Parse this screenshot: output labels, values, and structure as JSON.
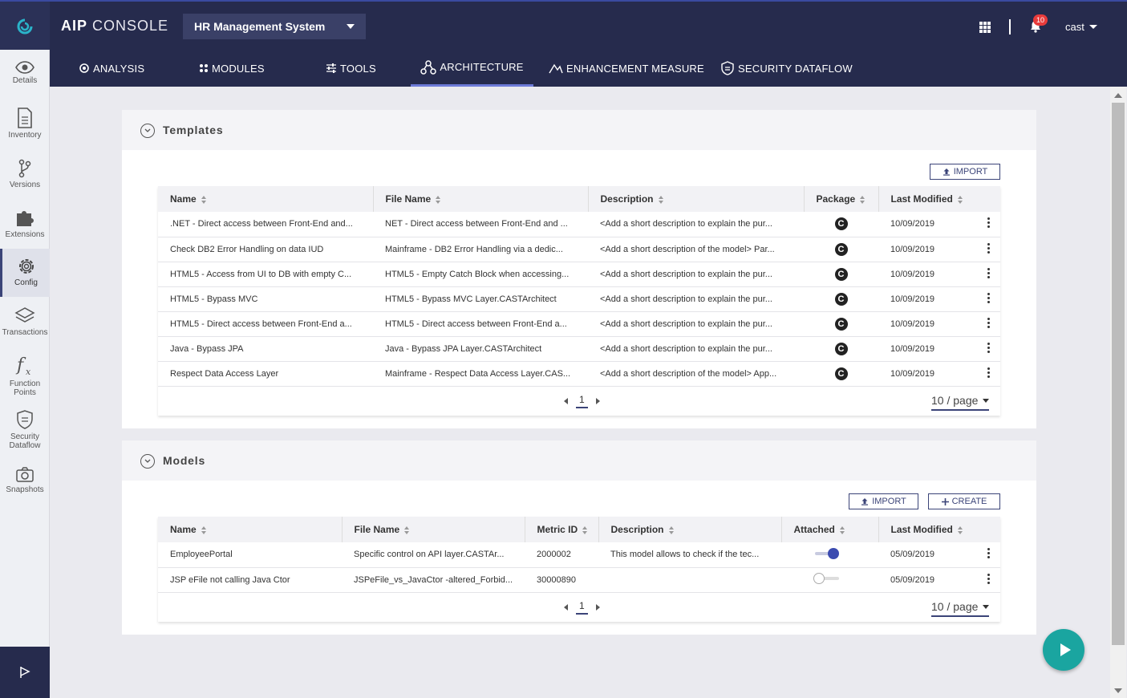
{
  "header": {
    "brand_bold": "AIP",
    "brand_light": "CONSOLE",
    "app_selector": "HR Management System",
    "notification_count": "10",
    "user": "cast"
  },
  "nav": {
    "items": [
      {
        "label": "ANALYSIS"
      },
      {
        "label": "MODULES"
      },
      {
        "label": "TOOLS"
      },
      {
        "label": "ARCHITECTURE",
        "active": true
      },
      {
        "label": "ENHANCEMENT MEASURE"
      },
      {
        "label": "SECURITY DATAFLOW"
      }
    ]
  },
  "sidebar": {
    "items": [
      {
        "label": "Details",
        "icon": "eye-icon"
      },
      {
        "label": "Inventory",
        "icon": "document-icon"
      },
      {
        "label": "Versions",
        "icon": "branch-icon"
      },
      {
        "label": "Extensions",
        "icon": "puzzle-icon"
      },
      {
        "label": "Config",
        "icon": "gear-icon",
        "active": true
      },
      {
        "label": "Transactions",
        "icon": "layers-icon"
      },
      {
        "label": "Function",
        "label2": "Points",
        "icon": "function-icon"
      },
      {
        "label": "Security",
        "label2": "Dataflow",
        "icon": "shield-icon"
      },
      {
        "label": "Snapshots",
        "icon": "camera-icon"
      }
    ]
  },
  "templates": {
    "title": "Templates",
    "import_label": "IMPORT",
    "columns": [
      "Name",
      "File Name",
      "Description",
      "Package",
      "Last Modified"
    ],
    "rows": [
      {
        "name": ".NET - Direct access between Front-End and...",
        "file": "NET - Direct access between Front-End and ...",
        "desc": "<Add a short description to explain the pur...",
        "pkg": "C",
        "modified": "10/09/2019"
      },
      {
        "name": "Check DB2 Error Handling on data IUD",
        "file": "Mainframe - DB2 Error Handling via a dedic...",
        "desc": "<Add a short description of the model> Par...",
        "pkg": "C",
        "modified": "10/09/2019"
      },
      {
        "name": "HTML5 - Access from UI to DB with empty C...",
        "file": "HTML5 - Empty Catch Block when accessing...",
        "desc": "<Add a short description to explain the pur...",
        "pkg": "C",
        "modified": "10/09/2019"
      },
      {
        "name": "HTML5 - Bypass MVC",
        "file": "HTML5 - Bypass MVC Layer.CASTArchitect",
        "desc": "<Add a short description to explain the pur...",
        "pkg": "C",
        "modified": "10/09/2019"
      },
      {
        "name": "HTML5 - Direct access between Front-End a...",
        "file": "HTML5 - Direct access between Front-End a...",
        "desc": "<Add a short description to explain the pur...",
        "pkg": "C",
        "modified": "10/09/2019"
      },
      {
        "name": "Java - Bypass JPA",
        "file": "Java - Bypass JPA Layer.CASTArchitect",
        "desc": "<Add a short description to explain the pur...",
        "pkg": "C",
        "modified": "10/09/2019"
      },
      {
        "name": "Respect Data Access Layer",
        "file": "Mainframe - Respect Data Access Layer.CAS...",
        "desc": "<Add a short description of the model> App...",
        "pkg": "C",
        "modified": "10/09/2019"
      }
    ],
    "page": "1",
    "page_size": "10 / page"
  },
  "models": {
    "title": "Models",
    "import_label": "IMPORT",
    "create_label": "CREATE",
    "columns": [
      "Name",
      "File Name",
      "Metric ID",
      "Description",
      "Attached",
      "Last Modified"
    ],
    "rows": [
      {
        "name": "EmployeePortal",
        "file": "Specific control on API layer.CASTAr...",
        "metric": "2000002",
        "desc": "This model allows to check if the tec...",
        "attached": true,
        "modified": "05/09/2019"
      },
      {
        "name": "JSP eFile not calling Java Ctor",
        "file": "JSPeFile_vs_JavaCtor -altered_Forbid...",
        "metric": "30000890",
        "desc": "",
        "attached": false,
        "modified": "05/09/2019"
      }
    ],
    "page": "1",
    "page_size": "10 / page"
  },
  "colors": {
    "header": "#262b4d",
    "accent": "#3b4478",
    "fab": "#1aa5a0",
    "badge": "#e83b3b"
  }
}
